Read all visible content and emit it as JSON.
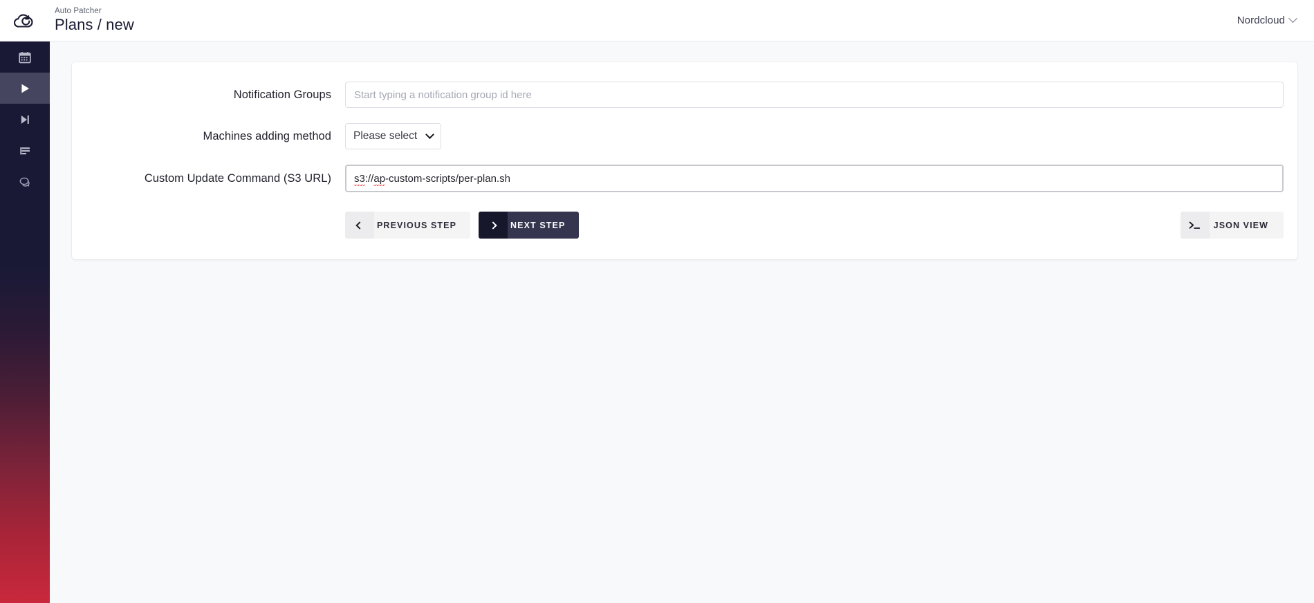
{
  "header": {
    "logo_icon": "cloud-refresh-logo",
    "app_name": "Auto Patcher",
    "page_title": "Plans / new",
    "account": {
      "name": "Nordcloud",
      "chevron_icon": "chevron-down-icon"
    }
  },
  "sidebar": {
    "items": [
      {
        "icon": "calendar-icon",
        "active": false
      },
      {
        "icon": "play-icon",
        "active": true
      },
      {
        "icon": "skip-forward-icon",
        "active": false
      },
      {
        "icon": "list-icon",
        "active": false
      },
      {
        "icon": "chat-bubble-icon",
        "active": false
      }
    ],
    "gradient_top": "#191936",
    "gradient_bottom": "#c9283c",
    "active_bg": "#454560"
  },
  "form": {
    "fields": [
      {
        "label": "Notification Groups",
        "type": "text",
        "value": "",
        "placeholder": "Start typing a notification group id here"
      },
      {
        "label": "Machines adding method",
        "type": "select",
        "value": "Please select"
      },
      {
        "label": "Custom Update Command (S3 URL)",
        "type": "text",
        "value": "s3://ap-custom-scripts/per-plan.sh",
        "placeholder": "",
        "focused": true,
        "spellcheck_words": [
          "s3",
          "ap"
        ]
      }
    ]
  },
  "actions": {
    "previous_step": {
      "label": "PREVIOUS STEP",
      "icon": "chevron-left-icon"
    },
    "next_step": {
      "label": "NEXT STEP",
      "icon": "chevron-right-icon"
    },
    "json_view": {
      "label": "JSON VIEW",
      "icon": "terminal-prompt-icon"
    }
  },
  "value_parts": {
    "s3_scheme": "s3",
    "s3_sep": "://",
    "s3_host": "ap",
    "s3_rest": "-custom-scripts/per-plan.sh"
  }
}
